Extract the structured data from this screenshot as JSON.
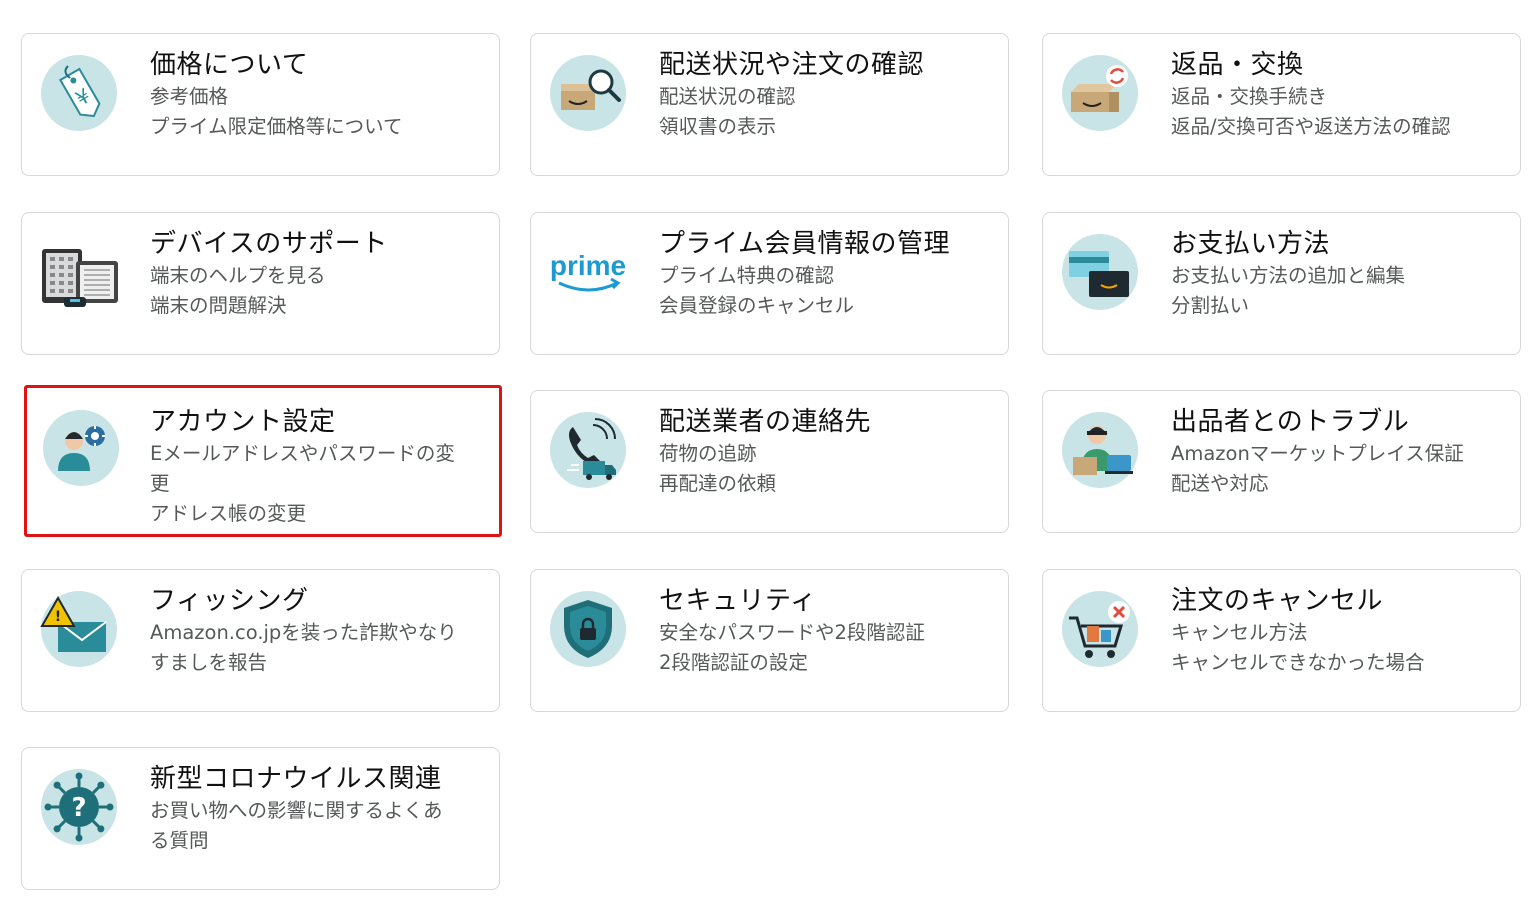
{
  "colors": {
    "icon_bg": "#c9e4e6",
    "teal": "#2a8c99",
    "dark_teal": "#1f6f7a",
    "highlight": "#e11212",
    "card_border": "#d5d9d9"
  },
  "cards": [
    {
      "id": "price",
      "icon": "price-tag-icon",
      "title": "価格について",
      "lines": [
        "参考価格",
        "プライム限定価格等について"
      ]
    },
    {
      "id": "delivery",
      "icon": "package-search-icon",
      "title": "配送状況や注文の確認",
      "lines": [
        "配送状況の確認",
        "領収書の表示"
      ]
    },
    {
      "id": "returns",
      "icon": "return-box-icon",
      "title": "返品・交換",
      "lines": [
        "返品・交換手続き",
        "返品/交換可否や返送方法の確認"
      ]
    },
    {
      "id": "devices",
      "icon": "devices-icon",
      "title": "デバイスのサポート",
      "lines": [
        "端末のヘルプを見る",
        "端末の問題解決"
      ]
    },
    {
      "id": "prime",
      "icon": "prime-logo-icon",
      "icon_text": "prime",
      "title": "プライム会員情報の管理",
      "lines": [
        "プライム特典の確認",
        "会員登録のキャンセル"
      ]
    },
    {
      "id": "payment",
      "icon": "payment-cards-icon",
      "title": "お支払い方法",
      "lines": [
        "お支払い方法の追加と編集",
        "分割払い"
      ]
    },
    {
      "id": "account",
      "icon": "account-settings-icon",
      "title": "アカウント設定",
      "lines": [
        "Eメールアドレスやパスワードの変",
        "更",
        "アドレス帳の変更"
      ],
      "highlighted": true
    },
    {
      "id": "carrier",
      "icon": "carrier-phone-icon",
      "title": "配送業者の連絡先",
      "lines": [
        "荷物の追跡",
        "再配達の依頼"
      ]
    },
    {
      "id": "seller",
      "icon": "seller-icon",
      "title": "出品者とのトラブル",
      "lines": [
        "Amazonマーケットプレイス保証",
        "配送や対応"
      ]
    },
    {
      "id": "phishing",
      "icon": "phishing-warning-icon",
      "title": "フィッシング",
      "lines": [
        "Amazon.co.jpを装った詐欺やなり",
        "すましを報告"
      ]
    },
    {
      "id": "security",
      "icon": "security-shield-icon",
      "title": "セキュリティ",
      "lines": [
        "安全なパスワードや2段階認証",
        "2段階認証の設定"
      ]
    },
    {
      "id": "cancel",
      "icon": "cart-cancel-icon",
      "title": "注文のキャンセル",
      "lines": [
        "キャンセル方法",
        "キャンセルできなかった場合"
      ]
    },
    {
      "id": "covid",
      "icon": "virus-question-icon",
      "title": "新型コロナウイルス関連",
      "lines": [
        "お買い物への影響に関するよくあ",
        "る質問"
      ]
    }
  ]
}
